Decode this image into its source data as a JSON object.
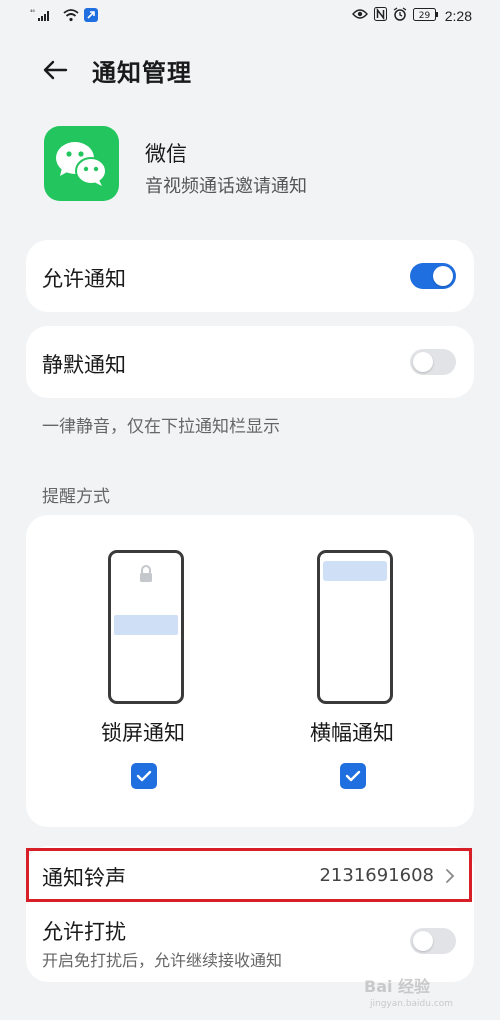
{
  "status_bar": {
    "signal": "⁴⁶",
    "battery": "29",
    "time": "2:28"
  },
  "header": {
    "title": "通知管理"
  },
  "app": {
    "name": "微信",
    "subtitle": "音视频通话邀请通知"
  },
  "allow_notifications": {
    "label": "允许通知",
    "enabled": true
  },
  "silent_notifications": {
    "label": "静默通知",
    "enabled": false,
    "hint": "一律静音，仅在下拉通知栏显示"
  },
  "reminder": {
    "section_title": "提醒方式",
    "options": [
      {
        "label": "锁屏通知",
        "checked": true
      },
      {
        "label": "横幅通知",
        "checked": true
      }
    ]
  },
  "ringtone": {
    "label": "通知铃声",
    "value": "2131691608"
  },
  "dnd": {
    "label": "允许打扰",
    "sub": "开启免打扰后，允许继续接收通知",
    "enabled": false
  },
  "watermark": {
    "text": "Bai 经验",
    "url": "jingyan.baidu.com"
  },
  "colors": {
    "accent": "#1f6fe0",
    "wechat_green": "#22c55e",
    "highlight_red": "#d61f26"
  }
}
